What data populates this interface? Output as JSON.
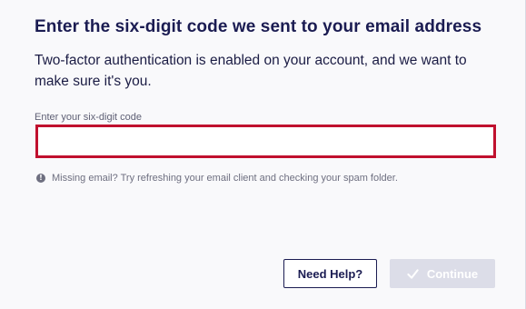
{
  "dialog": {
    "title": "Enter the six-digit code we sent to your email address",
    "subtitle": "Two-factor authentication is enabled on your account, and we want to make sure it's you."
  },
  "code_field": {
    "label": "Enter your six-digit code",
    "value": "",
    "placeholder": ""
  },
  "hint": {
    "icon": "info-icon",
    "text": "Missing email? Try refreshing your email client and checking your spam folder."
  },
  "buttons": {
    "help_label": "Need Help?",
    "continue_label": "Continue",
    "continue_icon": "check-icon",
    "continue_enabled": false
  },
  "colors": {
    "title": "#1b1c52",
    "input_border_error": "#c0102e",
    "continue_disabled_bg": "#dcdde8",
    "hint_text": "#6e6f80"
  }
}
